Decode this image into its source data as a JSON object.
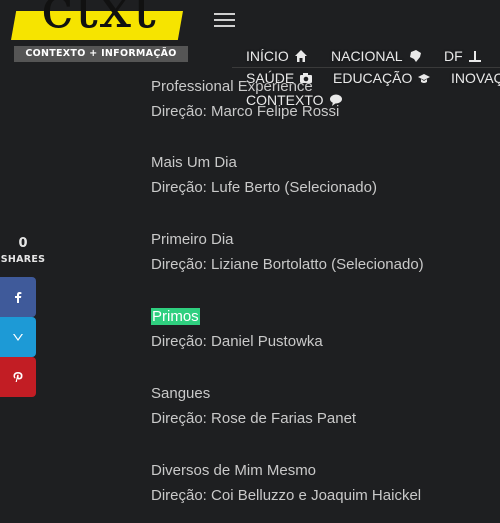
{
  "header": {
    "logo_word": "ctxt",
    "logo_subtitle": "CONTEXTO + INFORMAÇÃO",
    "menu": [
      {
        "label": "INÍCIO",
        "icon": "home-icon"
      },
      {
        "label": "NACIONAL",
        "icon": "brazil-map-icon"
      },
      {
        "label": "DF",
        "icon": "monument-icon"
      },
      {
        "label": "SAÚDE",
        "icon": "camera-icon"
      },
      {
        "label": "EDUCAÇÃO",
        "icon": "graduation-cap-icon"
      },
      {
        "label": "INOVAÇ"
      },
      {
        "label": "CONTEXTO",
        "icon": "speech-bubble-icon"
      }
    ]
  },
  "share": {
    "count": "0",
    "label": "SHARES",
    "buttons": [
      {
        "network": "facebook",
        "icon": "facebook-icon",
        "color": "#3f5a9a"
      },
      {
        "network": "twitter",
        "icon": "twitter-icon",
        "color": "#1d9ad6"
      },
      {
        "network": "pinterest",
        "icon": "pinterest-icon",
        "color": "#c21d24"
      }
    ]
  },
  "films": [
    {
      "title": "Professional Experience",
      "director": "Direção: Marco Felipe Rossi"
    },
    {
      "title": "Mais Um Dia",
      "director": "Direção: Lufe Berto (Selecionado)"
    },
    {
      "title": "Primeiro Dia",
      "director": "Direção: Liziane Bortolatto (Selecionado)"
    },
    {
      "title": "Primos",
      "director": "Direção: Daniel Pustowka",
      "highlighted": true
    },
    {
      "title": "Sangues",
      "director": "Direção: Rose de Farias Panet"
    },
    {
      "title": "Diversos de Mim Mesmo",
      "director": "Direção: Coi Belluzzo e Joaquim Haickel"
    }
  ],
  "colors": {
    "background": "#1e1f21",
    "logo_yellow": "#f6e400",
    "highlight": "#2fcf7f"
  }
}
